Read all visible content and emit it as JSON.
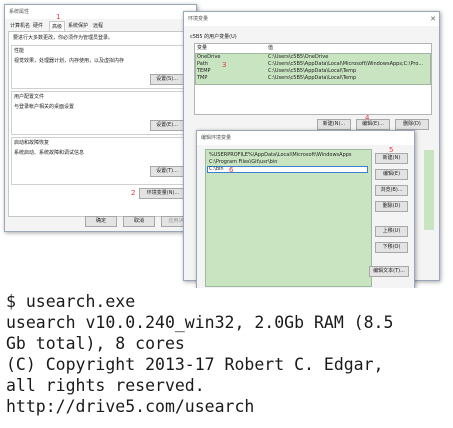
{
  "sysprops": {
    "title": "系统属性",
    "tabs": [
      "计算机名",
      "硬件",
      "高级",
      "系统保护",
      "远程"
    ],
    "tab_marker": "1",
    "notice": "要进行大多数更改，你必须作为管理员登录。",
    "perf_title": "性能",
    "perf_desc": "视觉效果，处理器计划，内存使用，以及虚拟内存",
    "profile_title": "用户配置文件",
    "profile_desc": "与登录帐户相关的桌面设置",
    "startup_title": "启动和故障恢复",
    "startup_desc": "系统启动、系统故障和调试信息",
    "settings_label": "设置(S)...",
    "settings_label_e": "设置(E)...",
    "settings_label_t": "设置(T)...",
    "env_button": "环境变量(N)...",
    "env_marker": "2",
    "ok": "确定",
    "cancel": "取消",
    "apply": "应用(A)"
  },
  "envvars": {
    "title": "环境变量",
    "user_vars_title": "c5B5 的用户变量(U)",
    "col_var": "变量",
    "col_val": "值",
    "rows": [
      {
        "name": "OneDrive",
        "value": "C:\\Users\\c5B5\\OneDrive"
      },
      {
        "name": "Path",
        "value": "C:\\Users\\c5B5\\AppData\\Local\\Microsoft\\WindowsApps;C:\\Pro..."
      },
      {
        "name": "TEMP",
        "value": "C:\\Users\\c5B5\\AppData\\Local\\Temp"
      },
      {
        "name": "TMP",
        "value": "C:\\Users\\c5B5\\AppData\\Local\\Temp"
      }
    ],
    "path_marker": "3",
    "new": "新建(N)...",
    "edit": "编辑(E)...",
    "delete": "删除(D)",
    "edit_marker": "4"
  },
  "editenv": {
    "title": "编辑环境变量",
    "entries": [
      "%USERPROFILE%\\AppData\\Local\\Microsoft\\WindowsApps",
      "C:\\Program Files\\Git\\usr\\bin",
      "C:\\bin"
    ],
    "new_entry_marker": "6",
    "new_marker": "5",
    "buttons": [
      "新建(N)",
      "编辑(E)",
      "浏览(B)...",
      "删除(D)",
      "上移(U)",
      "下移(O)",
      "编辑文本(T)..."
    ]
  },
  "terminal": {
    "lines": [
      "$ usearch.exe",
      "usearch v10.0.240_win32, 2.0Gb RAM (8.5",
      "Gb total), 8 cores",
      "(C) Copyright 2013-17 Robert C. Edgar,",
      "all rights reserved.",
      "http://drive5.com/usearch"
    ]
  },
  "colors": {
    "list_green": "#c9e4c1",
    "marker_red": "#e03a3a",
    "terminal_text": "#1a1a1a"
  }
}
